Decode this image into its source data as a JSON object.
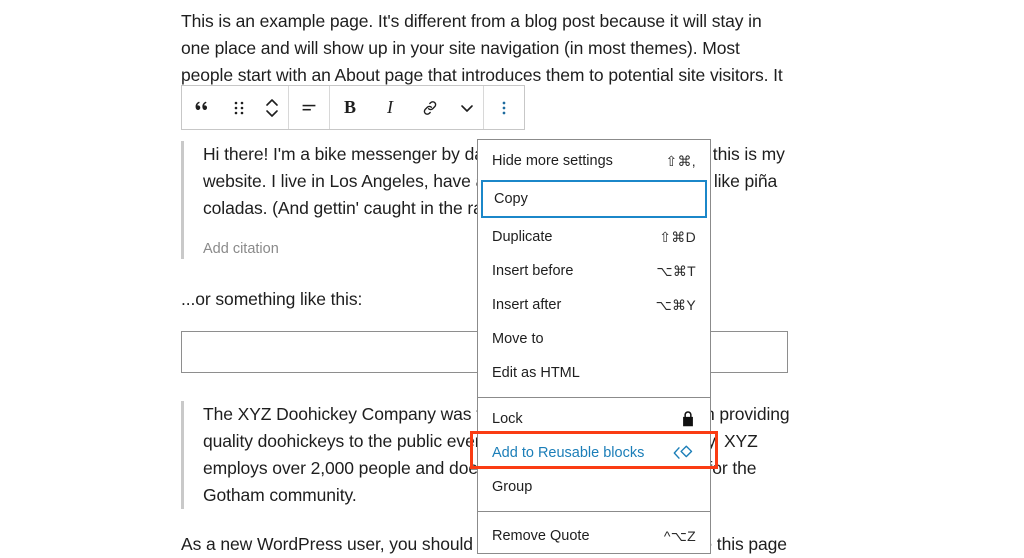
{
  "editor": {
    "intro_paragraph": "This is an example page. It's different from a blog post because it will stay in one place and will show up in your site navigation (in most themes). Most people start with an About page that introduces them to potential site visitors. It might say",
    "quote_one": {
      "text": "Hi there! I'm a bike messenger by day, aspiring actor by night, and this is my website. I live in Los Angeles, have a great dog named Jack, and I like piña coladas. (And gettin' caught in the rain.)",
      "citation_placeholder": "Add citation"
    },
    "or_something_paragraph": "...or something like this:",
    "quote_two": {
      "text": "The XYZ Doohickey Company was founded in 1971, and has been providing quality doohickeys to the public ever since. Located in Gotham City, XYZ employs over 2,000 people and does all kinds of awesome things for the Gotham community."
    },
    "closing_paragraph": "As a new WordPress user, you should go to your dashboard to delete this page"
  },
  "toolbar": {
    "buttons": [
      {
        "name": "quote-block-type",
        "icon": "quote-icon",
        "label": "Quote"
      },
      {
        "name": "drag-handle",
        "icon": "drag-handle-icon",
        "label": "Drag"
      },
      {
        "name": "move-updown",
        "icon": "chevron-up-down-icon",
        "label": "Move up or down"
      },
      {
        "name": "align-text",
        "icon": "align-icon",
        "label": "Change alignment"
      },
      {
        "name": "bold",
        "icon": "bold-icon",
        "label": "B"
      },
      {
        "name": "italic",
        "icon": "italic-icon",
        "label": "I"
      },
      {
        "name": "link",
        "icon": "link-icon",
        "label": "Link"
      },
      {
        "name": "more-rich-text",
        "icon": "chevron-down-icon",
        "label": "More"
      },
      {
        "name": "block-options",
        "icon": "vertical-ellipsis-icon",
        "label": "Options"
      }
    ]
  },
  "menu": {
    "groups": [
      {
        "items": [
          {
            "label": "Hide more settings",
            "shortcut": "⇧⌘,",
            "icon": null,
            "state": "normal"
          },
          {
            "label": "Copy",
            "shortcut": "",
            "icon": null,
            "state": "focused"
          },
          {
            "label": "Duplicate",
            "shortcut": "⇧⌘D",
            "icon": null,
            "state": "normal"
          },
          {
            "label": "Insert before",
            "shortcut": "⌥⌘T",
            "icon": null,
            "state": "normal"
          },
          {
            "label": "Insert after",
            "shortcut": "⌥⌘Y",
            "icon": null,
            "state": "normal"
          },
          {
            "label": "Move to",
            "shortcut": "",
            "icon": null,
            "state": "normal"
          },
          {
            "label": "Edit as HTML",
            "shortcut": "",
            "icon": null,
            "state": "normal"
          }
        ]
      },
      {
        "items": [
          {
            "label": "Lock",
            "shortcut": "",
            "icon": "lock-icon",
            "state": "normal"
          },
          {
            "label": "Add to Reusable blocks",
            "shortcut": "",
            "icon": "reusable-block-icon",
            "state": "highlighted"
          },
          {
            "label": "Group",
            "shortcut": "",
            "icon": null,
            "state": "normal"
          }
        ]
      },
      {
        "items": [
          {
            "label": "Remove Quote",
            "shortcut": "^⌥Z",
            "icon": null,
            "state": "normal"
          }
        ]
      }
    ]
  },
  "annotation": {
    "color": "#fa3c13",
    "target": "Add to Reusable blocks"
  },
  "colors": {
    "accent_blue": "#1b7eb8",
    "focus_blue": "#1b87c9",
    "annotation_red": "#fa3c13",
    "text": "#1e1e1e",
    "muted": "#8a8a8a",
    "border": "#8b8b8b"
  }
}
